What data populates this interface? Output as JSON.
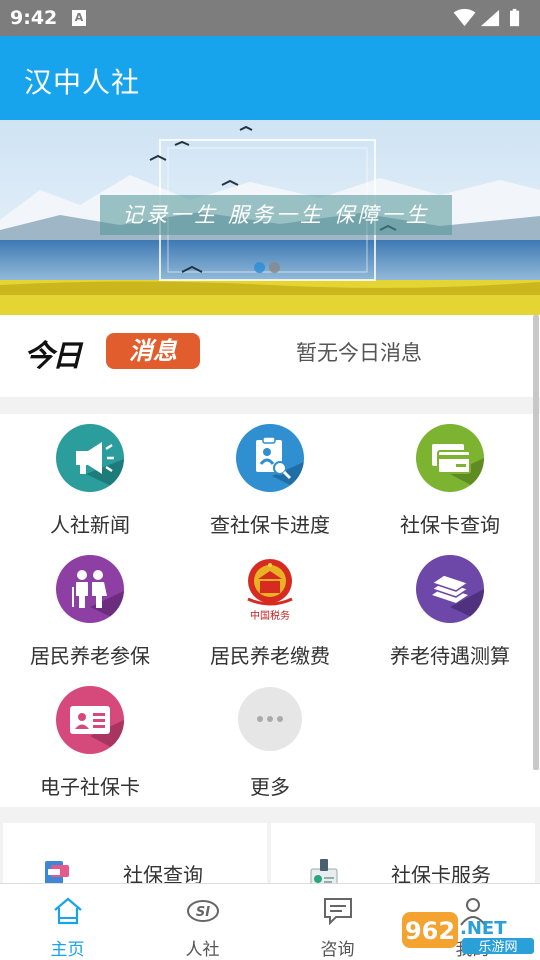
{
  "status_bar": {
    "time": "9:42",
    "notif_icon": "A"
  },
  "app_bar": {
    "title": "汉中人社"
  },
  "banner": {
    "slogan": "记录一生 服务一生 保障一生",
    "slide_count": 2,
    "active_slide": 1
  },
  "today": {
    "logo_left": "今日",
    "logo_right": "消息",
    "message": "暂无今日消息"
  },
  "grid": {
    "items": [
      {
        "label": "人社新闻",
        "icon": "megaphone-icon",
        "color": "#2a9d9c"
      },
      {
        "label": "查社保卡进度",
        "icon": "clipboard-search-icon",
        "color": "#2f8fd0"
      },
      {
        "label": "社保卡查询",
        "icon": "card-stack-icon",
        "color": "#7cb331"
      },
      {
        "label": "居民养老参保",
        "icon": "elderly-couple-icon",
        "color": "#8e3fa4"
      },
      {
        "label": "居民养老缴费",
        "icon": "national-emblem-icon",
        "color": "#d72b22"
      },
      {
        "label": "养老待遇测算",
        "icon": "books-icon",
        "color": "#6d48a8"
      },
      {
        "label": "电子社保卡",
        "icon": "id-card-icon",
        "color": "#d6497b"
      },
      {
        "label": "更多",
        "icon": "more-dots-icon",
        "color": "#e6e6e6"
      }
    ]
  },
  "cards": [
    {
      "label": "社保查询",
      "icon": "phone-card-icon"
    },
    {
      "label": "社保卡服务",
      "icon": "badge-icon"
    }
  ],
  "bottom_nav": [
    {
      "label": "主页",
      "icon": "home-icon",
      "active": true
    },
    {
      "label": "人社",
      "icon": "si-logo-icon",
      "active": false
    },
    {
      "label": "咨询",
      "icon": "chat-icon",
      "active": false
    },
    {
      "label": "我的",
      "icon": "person-icon",
      "active": false
    }
  ],
  "watermark": {
    "text1": "962.NET",
    "text2": "乐游网"
  },
  "colors": {
    "primary": "#18a4ec",
    "status_bar": "#7d7d7d",
    "divider": "#f2f2f2"
  }
}
